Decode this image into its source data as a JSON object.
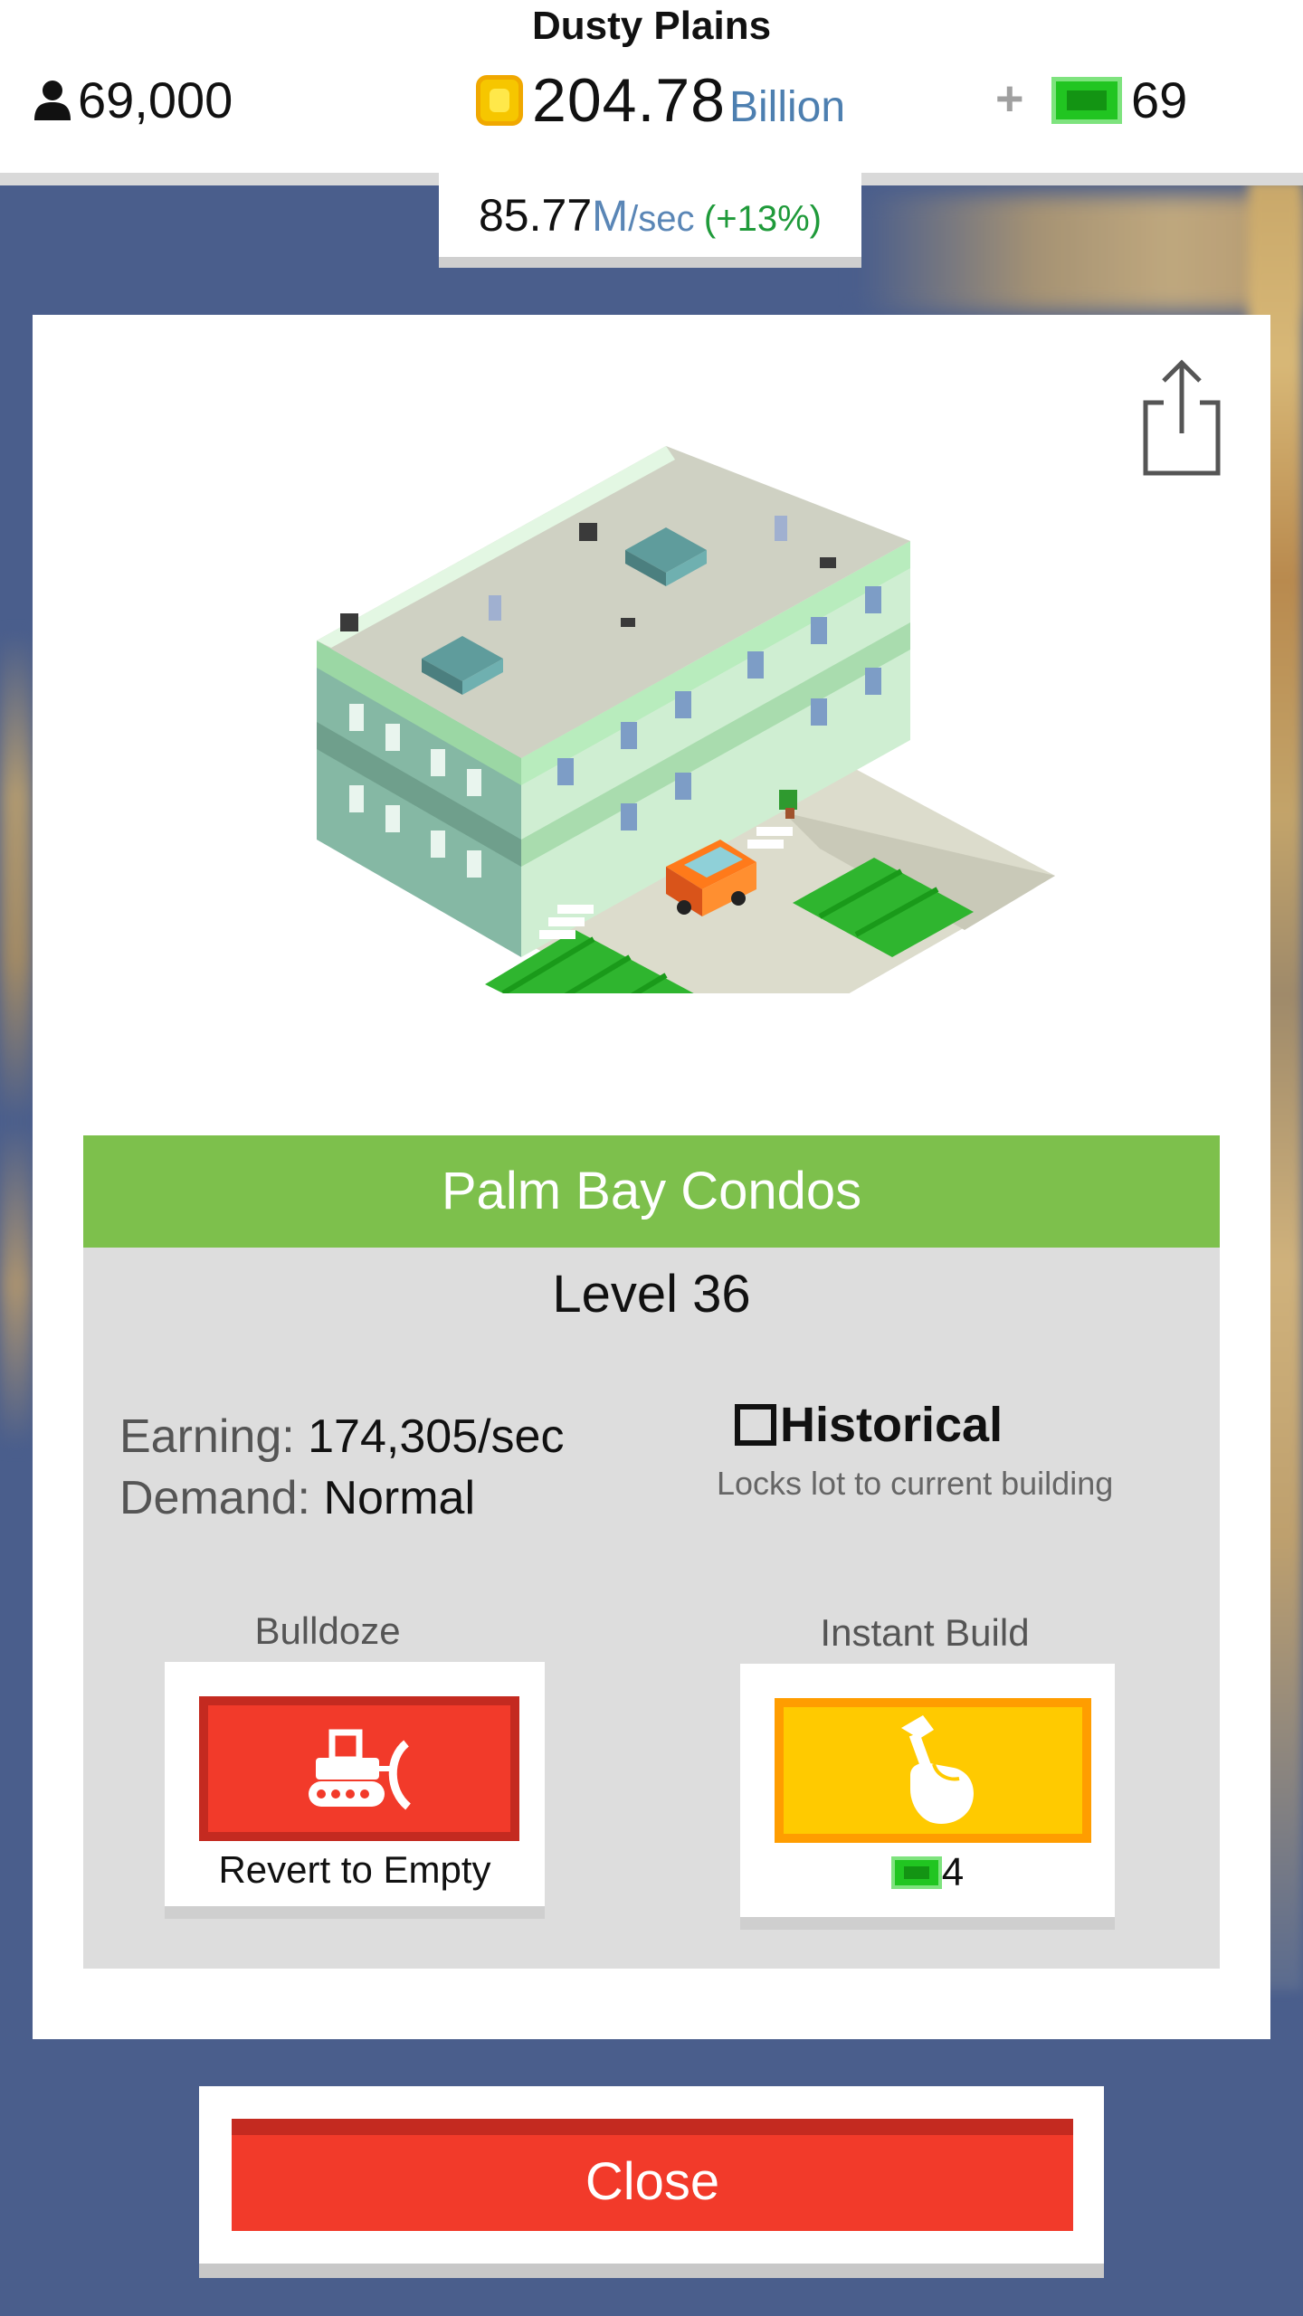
{
  "header": {
    "city_name": "Dusty Plains",
    "population": "69,000",
    "money_value": "204.78",
    "money_unit": "Billion",
    "plus_label": "+",
    "cash": "69",
    "rate_value": "85.77",
    "rate_unit": "M",
    "rate_per": "/sec",
    "rate_bonus": "(+13%)"
  },
  "building": {
    "name": "Palm Bay Condos",
    "level": "Level 36",
    "earning_label": "Earning:",
    "earning_value": "174,305/sec",
    "demand_label": "Demand:",
    "demand_value": "Normal",
    "historical_label": "Historical",
    "historical_sub": "Locks lot to current building",
    "historical_checked": false
  },
  "actions": {
    "bulldoze_label": "Bulldoze",
    "bulldoze_button_text": "Revert to Empty",
    "instant_label": "Instant Build",
    "instant_cost": "4"
  },
  "footer": {
    "close_label": "Close"
  },
  "colors": {
    "name_bar": "#7dc04c",
    "bulldoze": "#f23a2a",
    "instant": "#ffca00",
    "close": "#f23a2a",
    "background": "#4a5e8c"
  },
  "icons": [
    "person-icon",
    "coin-icon",
    "cash-icon",
    "share-icon",
    "bulldozer-icon",
    "hammer-hand-icon"
  ]
}
